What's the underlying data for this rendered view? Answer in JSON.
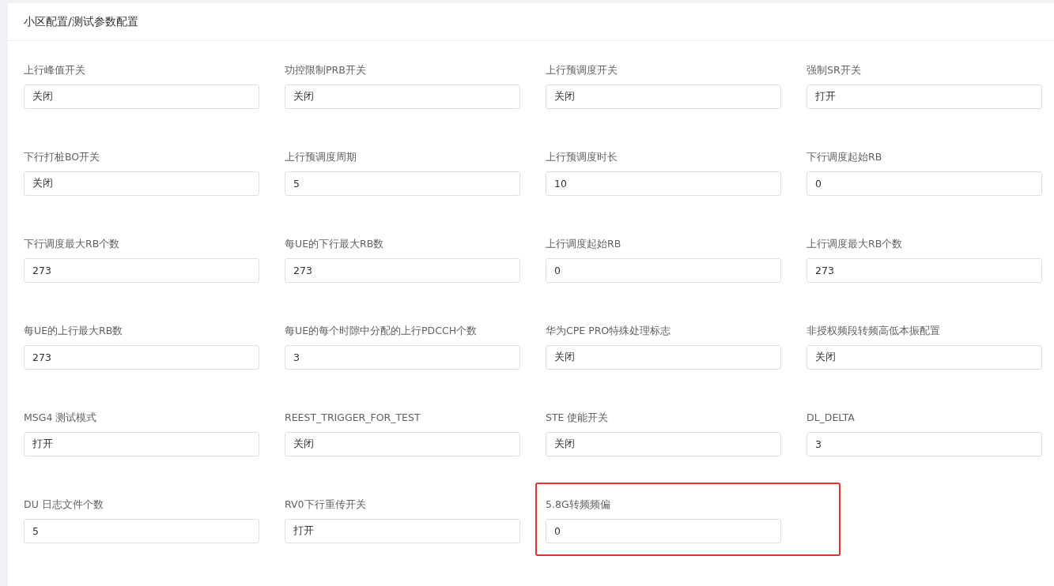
{
  "panel": {
    "title": "小区配置/测试参数配置"
  },
  "fields": [
    {
      "label": "上行峰值开关",
      "value": "关闭",
      "highlighted": false
    },
    {
      "label": "功控限制PRB开关",
      "value": "关闭",
      "highlighted": false
    },
    {
      "label": "上行预调度开关",
      "value": "关闭",
      "highlighted": false
    },
    {
      "label": "强制SR开关",
      "value": "打开",
      "highlighted": false
    },
    {
      "label": "下行打桩BO开关",
      "value": "关闭",
      "highlighted": false
    },
    {
      "label": "上行预调度周期",
      "value": "5",
      "highlighted": false
    },
    {
      "label": "上行预调度时长",
      "value": "10",
      "highlighted": false
    },
    {
      "label": "下行调度起始RB",
      "value": "0",
      "highlighted": false
    },
    {
      "label": "下行调度最大RB个数",
      "value": "273",
      "highlighted": false
    },
    {
      "label": "每UE的下行最大RB数",
      "value": "273",
      "highlighted": false
    },
    {
      "label": "上行调度起始RB",
      "value": "0",
      "highlighted": false
    },
    {
      "label": "上行调度最大RB个数",
      "value": "273",
      "highlighted": false
    },
    {
      "label": "每UE的上行最大RB数",
      "value": "273",
      "highlighted": false
    },
    {
      "label": "每UE的每个时隙中分配的上行PDCCH个数",
      "value": "3",
      "highlighted": false
    },
    {
      "label": "华为CPE PRO特殊处理标志",
      "value": "关闭",
      "highlighted": false
    },
    {
      "label": "非授权频段转频高低本振配置",
      "value": "关闭",
      "highlighted": false
    },
    {
      "label": "MSG4 测试模式",
      "value": "打开",
      "highlighted": false
    },
    {
      "label": "REEST_TRIGGER_FOR_TEST",
      "value": "关闭",
      "highlighted": false
    },
    {
      "label": "STE 使能开关",
      "value": "关闭",
      "highlighted": false
    },
    {
      "label": "DL_DELTA",
      "value": "3",
      "highlighted": false
    },
    {
      "label": "DU 日志文件个数",
      "value": "5",
      "highlighted": false
    },
    {
      "label": "RV0下行重传开关",
      "value": "打开",
      "highlighted": false
    },
    {
      "label": "5.8G转频频偏",
      "value": "0",
      "highlighted": true
    }
  ]
}
